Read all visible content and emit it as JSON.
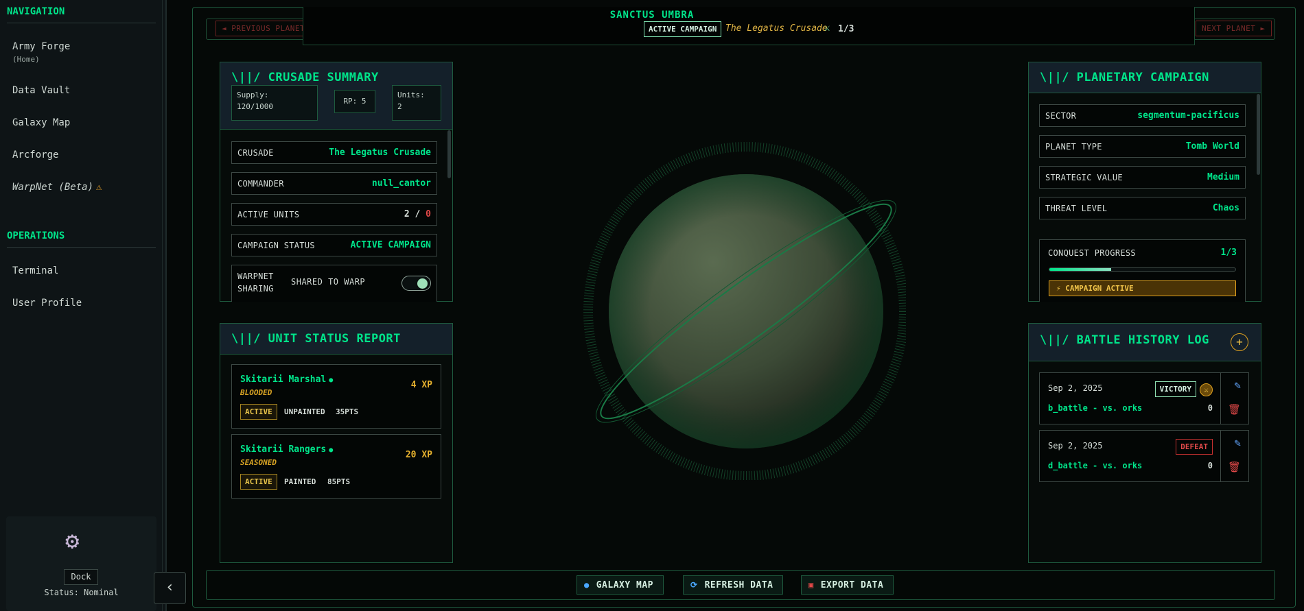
{
  "sidebar": {
    "nav_heading": "NAVIGATION",
    "nav_items": [
      {
        "label": "Army Forge",
        "sub": "(Home)"
      },
      {
        "label": "Data Vault"
      },
      {
        "label": "Galaxy Map"
      },
      {
        "label": "Arcforge"
      },
      {
        "label": "WarpNet (Beta)"
      }
    ],
    "ops_heading": "OPERATIONS",
    "ops_items": [
      {
        "label": "Terminal"
      },
      {
        "label": "User Profile"
      }
    ],
    "dock_label": "Dock",
    "status_text": "Status: Nominal",
    "collapse_glyph": "‹",
    "icons": {
      "warning": "warning-icon",
      "settings": "gear-icon"
    }
  },
  "header": {
    "prev_label": "◄ PREVIOUS PLANET",
    "next_label": "NEXT PLANET ►",
    "planet_name": "SANCTUS UMBRA",
    "status_chip": "ACTIVE CAMPAIGN",
    "crusade_name": "The Legatus Crusade",
    "progress": "1/3"
  },
  "crusade_summary": {
    "title": "\\||/ CRUSADE SUMMARY",
    "supply_label": "Supply:",
    "supply_value": "120/1000",
    "rp": "RP: 5",
    "units_label": "Units:",
    "units_value": "2",
    "rows": [
      {
        "key": "CRUSADE",
        "value": "The Legatus Crusade"
      },
      {
        "key": "COMMANDER",
        "value": "null_cantor"
      },
      {
        "key": "ACTIVE UNITS",
        "value_a": "2",
        "sep": "/",
        "value_b": "0"
      },
      {
        "key": "CAMPAIGN STATUS",
        "value": "ACTIVE CAMPAIGN"
      }
    ],
    "sharing_key_1": "WARPNET",
    "sharing_key_2": "SHARING",
    "sharing_value": "SHARED TO WARP",
    "sharing_on": true
  },
  "unit_status": {
    "title": "\\||/ UNIT STATUS REPORT",
    "units": [
      {
        "name": "Skitarii Marshal",
        "rank": "BLOODED",
        "xp": "4 XP",
        "status": "ACTIVE",
        "paint": "UNPAINTED",
        "pts": "35PTS"
      },
      {
        "name": "Skitarii Rangers",
        "rank": "SEASONED",
        "xp": "20 XP",
        "status": "ACTIVE",
        "paint": "PAINTED",
        "pts": "85PTS"
      }
    ]
  },
  "planetary_campaign": {
    "title": "\\||/ PLANETARY CAMPAIGN",
    "rows": [
      {
        "key": "SECTOR",
        "value": "segmentum-pacificus"
      },
      {
        "key": "PLANET TYPE",
        "value": "Tomb World"
      },
      {
        "key": "STRATEGIC VALUE",
        "value": "Medium"
      },
      {
        "key": "THREAT LEVEL",
        "value": "Chaos"
      }
    ],
    "progress_label": "CONQUEST PROGRESS",
    "progress_value": "1/3",
    "progress_fraction": 0.333,
    "campaign_badge": "⚡ CAMPAIGN ACTIVE"
  },
  "battle_log": {
    "title": "\\||/ BATTLE HISTORY LOG",
    "add_glyph": "+",
    "battles": [
      {
        "date": "Sep 2, 2025",
        "result": "VICTORY",
        "name": "b_battle - vs. orks",
        "score": "0"
      },
      {
        "date": "Sep 2, 2025",
        "result": "DEFEAT",
        "name": "d_battle - vs. orks",
        "score": "0"
      }
    ]
  },
  "footer": {
    "galaxy_map": "GALAXY MAP",
    "refresh": "REFRESH DATA",
    "export": "EXPORT DATA"
  },
  "colors": {
    "accent": "#00e48a",
    "warning": "#e0a21f",
    "danger": "#e04848",
    "panel_border": "#1e5a3e"
  }
}
